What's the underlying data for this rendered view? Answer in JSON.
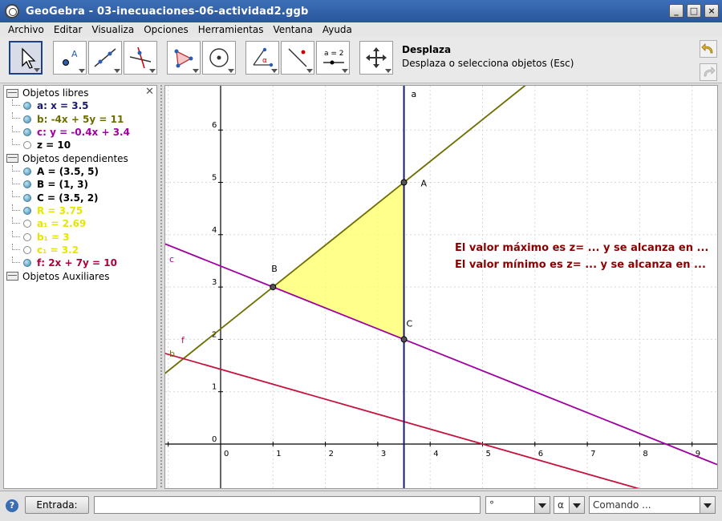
{
  "window": {
    "title": "GeoGebra - 03-inecuaciones-06-actividad2.ggb",
    "buttons": [
      "_",
      "□",
      "×"
    ]
  },
  "menu": [
    "Archivo",
    "Editar",
    "Visualiza",
    "Opciones",
    "Herramientas",
    "Ventana",
    "Ayuda"
  ],
  "toolbar": {
    "active_tool_name": "Desplaza",
    "active_tool_desc": "Desplaza o selecciona objetos (Esc)",
    "slider_tool_label": "a = 2",
    "point_tool_label": "A",
    "angle_tool_label": "α"
  },
  "algebra": {
    "folders": {
      "free": "Objetos libres",
      "dependent": "Objetos dependientes",
      "aux": "Objetos Auxiliares"
    },
    "free_objects": [
      {
        "text": "a: x = 3.5",
        "color": "#1a1a6e",
        "shown": true
      },
      {
        "text": "b: -4x + 5y = 11",
        "color": "#6e6e00",
        "shown": true
      },
      {
        "text": "c: y = -0.4x + 3.4",
        "color": "#a000a0",
        "shown": true
      },
      {
        "text": "z = 10",
        "color": "#000000",
        "shown": false
      }
    ],
    "dependent_objects": [
      {
        "text": "A = (3.5, 5)",
        "color": "#000000",
        "shown": true
      },
      {
        "text": "B = (1, 3)",
        "color": "#000000",
        "shown": true
      },
      {
        "text": "C = (3.5, 2)",
        "color": "#000000",
        "shown": true
      },
      {
        "text": "R = 3.75",
        "color": "#e6e600",
        "shown": true
      },
      {
        "text": "a₁ = 2.69",
        "color": "#e6e600",
        "shown": false
      },
      {
        "text": "b₁ = 3",
        "color": "#e6e600",
        "shown": false
      },
      {
        "text": "c₁ = 3.2",
        "color": "#e6e600",
        "shown": false
      },
      {
        "text": "f: 2x + 7y = 10",
        "color": "#b0003c",
        "shown": true
      }
    ]
  },
  "graphics": {
    "x_ticks": [
      "0",
      "1",
      "2",
      "3",
      "4",
      "5",
      "6",
      "7",
      "8",
      "9"
    ],
    "y_ticks": [
      "0",
      "1",
      "2",
      "3",
      "4",
      "5",
      "6"
    ],
    "labels": {
      "a": "a",
      "b": "b",
      "c": "c",
      "f": "f",
      "A": "A",
      "B": "B",
      "C": "C"
    },
    "text_max": "El valor máximo es z= ... y se alcanza en ...",
    "text_min": "El valor mínimo es z= ... y se alcanza en ...",
    "colors": {
      "line_a": "#1a1a6e",
      "line_b": "#6e6e00",
      "line_c": "#a000a0",
      "line_f": "#c8103c",
      "region": "#ffff66",
      "text": "#8b0000"
    }
  },
  "inputbar": {
    "help": "?",
    "label": "Entrada:",
    "value": "",
    "degree": "°",
    "alpha": "α",
    "command": "Comando ..."
  }
}
